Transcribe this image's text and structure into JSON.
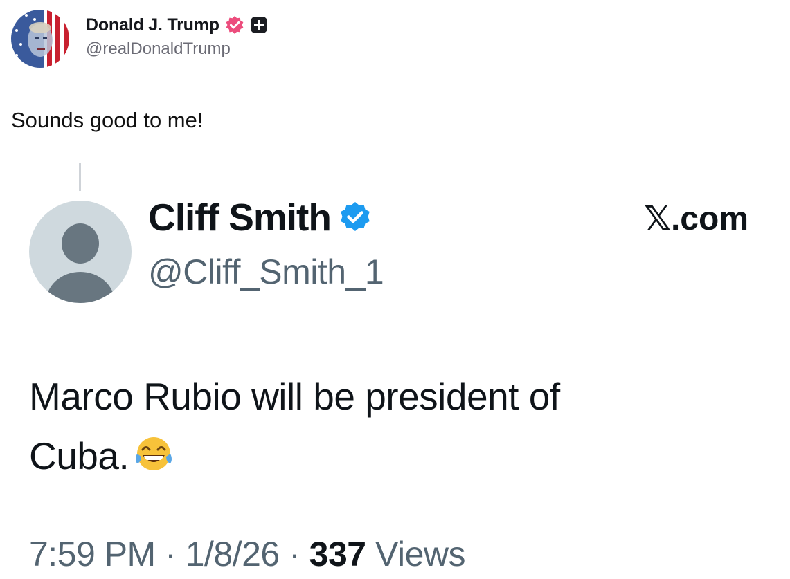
{
  "truth_post": {
    "author_name": "Donald J. Trump",
    "author_handle": "@realDonaldTrump",
    "verified_icon": "verified-badge-icon",
    "verified_color": "#ec4d7d",
    "follow_icon": "plus-icon",
    "text": "Sounds good to me!"
  },
  "embedded_post": {
    "author_name": "Cliff Smith",
    "author_handle": "@Cliff_Smith_1",
    "verified_icon": "verified-badge-icon",
    "verified_color": "#1d9bf0",
    "source": "𝕏.com",
    "text_line1": "Marco Rubio will be president of",
    "text_line2": "Cuba.",
    "emoji": "tears-of-joy-emoji",
    "time": "7:59 PM",
    "date": "1/8/26",
    "separator": "·",
    "views_count": "337",
    "views_label": "Views"
  }
}
